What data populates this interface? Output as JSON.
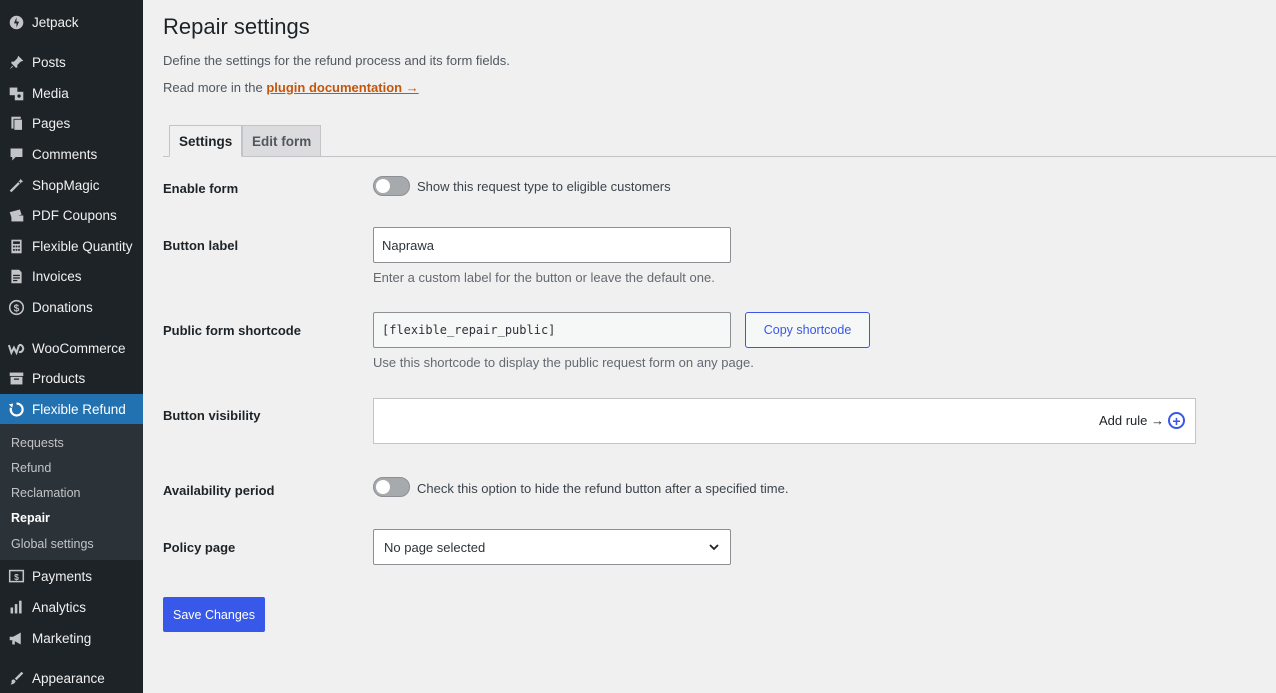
{
  "sidebar": {
    "items": [
      {
        "label": "Jetpack",
        "icon": "jetpack-icon"
      },
      {
        "label": "Posts",
        "icon": "pin-icon"
      },
      {
        "label": "Media",
        "icon": "media-icon"
      },
      {
        "label": "Pages",
        "icon": "pages-icon"
      },
      {
        "label": "Comments",
        "icon": "comments-icon"
      },
      {
        "label": "ShopMagic",
        "icon": "magic-wand-icon"
      },
      {
        "label": "PDF Coupons",
        "icon": "coupons-icon"
      },
      {
        "label": "Flexible Quantity",
        "icon": "calculator-icon"
      },
      {
        "label": "Invoices",
        "icon": "invoice-icon"
      },
      {
        "label": "Donations",
        "icon": "dollar-icon"
      },
      {
        "label": "WooCommerce",
        "icon": "woocommerce-icon"
      },
      {
        "label": "Products",
        "icon": "archive-icon"
      },
      {
        "label": "Flexible Refund",
        "icon": "refund-icon"
      },
      {
        "label": "Payments",
        "icon": "payments-icon"
      },
      {
        "label": "Analytics",
        "icon": "bar-chart-icon"
      },
      {
        "label": "Marketing",
        "icon": "megaphone-icon"
      },
      {
        "label": "Appearance",
        "icon": "paintbrush-icon"
      }
    ],
    "submenu": [
      {
        "label": "Requests"
      },
      {
        "label": "Refund"
      },
      {
        "label": "Reclamation"
      },
      {
        "label": "Repair"
      },
      {
        "label": "Global settings"
      }
    ],
    "accent_color": "#2271b1"
  },
  "page": {
    "title": "Repair settings",
    "description": "Define the settings for the refund process and its form fields.",
    "read_more_prefix": "Read more in the ",
    "doc_link": "plugin documentation →"
  },
  "tabs": [
    {
      "label": "Settings",
      "active": true
    },
    {
      "label": "Edit form",
      "active": false
    }
  ],
  "form": {
    "enable_form": {
      "label": "Enable form",
      "toggle_text": "Show this request type to eligible customers",
      "enabled": false
    },
    "button_label": {
      "label": "Button label",
      "value": "Naprawa",
      "help": "Enter a custom label for the button or leave the default one."
    },
    "shortcode": {
      "label": "Public form shortcode",
      "value": "[flexible_repair_public]",
      "copy_label": "Copy shortcode",
      "help": "Use this shortcode to display the public request form on any page."
    },
    "visibility": {
      "label": "Button visibility",
      "add_rule": "Add rule →"
    },
    "availability": {
      "label": "Availability period",
      "toggle_text": "Check this option to hide the refund button after a specified time.",
      "enabled": false
    },
    "policy_page": {
      "label": "Policy page",
      "selected": "No page selected"
    }
  },
  "save_label": "Save Changes",
  "button_color": "#3858e9"
}
